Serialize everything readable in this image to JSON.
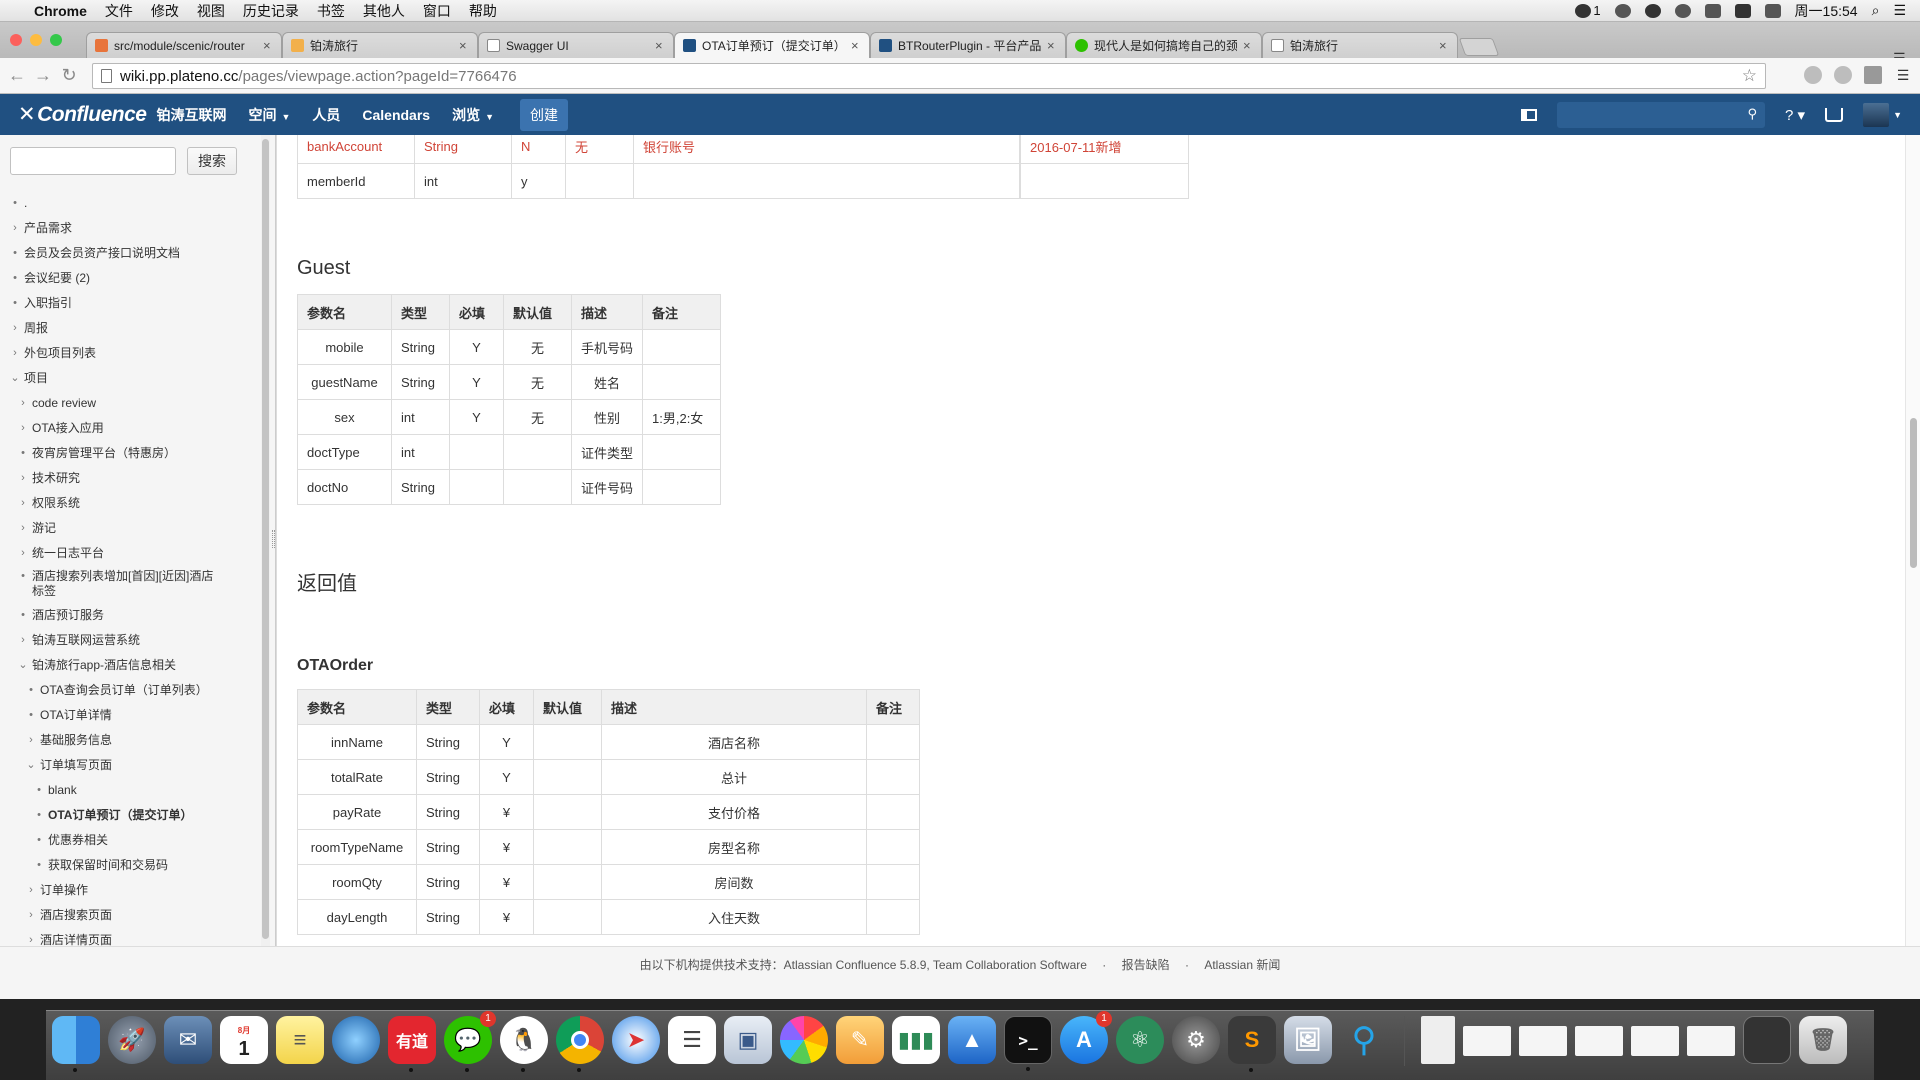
{
  "menubar": {
    "app": "Chrome",
    "items": [
      "文件",
      "修改",
      "视图",
      "历史记录",
      "书签",
      "其他人",
      "窗口",
      "帮助"
    ],
    "wechat_count": "1",
    "clock": "周一15:54"
  },
  "tabs": [
    {
      "label": "src/module/scenic/router",
      "color": "#e8743b"
    },
    {
      "label": "铂涛旅行",
      "color": "#f2b04b"
    },
    {
      "label": "Swagger UI",
      "color": "#ffffff"
    },
    {
      "label": "OTA订单预订（提交订单）",
      "color": "#205081"
    },
    {
      "label": "BTRouterPlugin - 平台产品",
      "color": "#205081"
    },
    {
      "label": "现代人是如何搞垮自己的颈",
      "color": "#2dc100"
    },
    {
      "label": "铂涛旅行",
      "color": "#ffffff"
    }
  ],
  "address": {
    "host": "wiki.pp.plateno.cc",
    "path": "/pages/viewpage.action?pageId=7766476"
  },
  "confluence": {
    "logo": "Confluence",
    "org": "铂涛互联网",
    "nav": {
      "spaces": "空间",
      "people": "人员",
      "calendars": "Calendars",
      "browse": "浏览",
      "create": "创建"
    }
  },
  "sidebar": {
    "search_button": "搜索",
    "tree": [
      {
        "label": ".",
        "marker": "•",
        "depth": 0
      },
      {
        "label": "产品需求",
        "marker": "›",
        "depth": 0
      },
      {
        "label": "会员及会员资产接口说明文档",
        "marker": "•",
        "depth": 0
      },
      {
        "label": "会议纪要 (2)",
        "marker": "•",
        "depth": 0
      },
      {
        "label": "入职指引",
        "marker": "•",
        "depth": 0
      },
      {
        "label": "周报",
        "marker": "›",
        "depth": 0
      },
      {
        "label": "外包项目列表",
        "marker": "›",
        "depth": 0
      },
      {
        "label": "项目",
        "marker": "⌄",
        "depth": 0
      },
      {
        "label": "code review",
        "marker": "›",
        "depth": 1
      },
      {
        "label": "OTA接入应用",
        "marker": "›",
        "depth": 1
      },
      {
        "label": "夜宵房管理平台（特惠房）",
        "marker": "•",
        "depth": 1
      },
      {
        "label": "技术研究",
        "marker": "›",
        "depth": 1
      },
      {
        "label": "权限系统",
        "marker": "›",
        "depth": 1
      },
      {
        "label": "游记",
        "marker": "›",
        "depth": 1
      },
      {
        "label": "统一日志平台",
        "marker": "›",
        "depth": 1
      },
      {
        "label": "酒店搜索列表增加[首因][近因]酒店",
        "label2": "标签",
        "marker": "•",
        "depth": 1
      },
      {
        "label": "酒店预订服务",
        "marker": "•",
        "depth": 1
      },
      {
        "label": "铂涛互联网运营系统",
        "marker": "›",
        "depth": 1
      },
      {
        "label": "铂涛旅行app-酒店信息相关",
        "marker": "⌄",
        "depth": 1
      },
      {
        "label": "OTA查询会员订单（订单列表）",
        "marker": "•",
        "depth": 2
      },
      {
        "label": "OTA订单详情",
        "marker": "•",
        "depth": 2
      },
      {
        "label": "基础服务信息",
        "marker": "›",
        "depth": 2
      },
      {
        "label": "订单填写页面",
        "marker": "⌄",
        "depth": 2
      },
      {
        "label": "blank",
        "marker": "•",
        "depth": 3
      },
      {
        "label": "OTA订单预订（提交订单）",
        "marker": "•",
        "depth": 3,
        "bold": true
      },
      {
        "label": "优惠券相关",
        "marker": "•",
        "depth": 3
      },
      {
        "label": "获取保留时间和交易码",
        "marker": "•",
        "depth": 3
      },
      {
        "label": "订单操作",
        "marker": "›",
        "depth": 2
      },
      {
        "label": "酒店搜索页面",
        "marker": "›",
        "depth": 2
      },
      {
        "label": "酒店详情页面",
        "marker": "›",
        "depth": 2
      }
    ]
  },
  "content": {
    "top_table": {
      "rows": [
        [
          "bankAccount",
          "String",
          "N",
          "无",
          "银行账号",
          "",
          "2016-07-11新增"
        ],
        [
          "memberId",
          "int",
          "y",
          "",
          "",
          "",
          ""
        ]
      ]
    },
    "guest": {
      "heading": "Guest",
      "headers": [
        "参数名",
        "类型",
        "必填",
        "默认值",
        "描述",
        "备注"
      ],
      "rows": [
        [
          "mobile",
          "String",
          "Y",
          "无",
          "手机号码",
          ""
        ],
        [
          "guestName",
          "String",
          "Y",
          "无",
          "姓名",
          ""
        ],
        [
          "sex",
          "int",
          "Y",
          "无",
          "性别",
          "1:男,2:女"
        ],
        [
          "doctType",
          "int",
          "",
          "",
          "证件类型",
          ""
        ],
        [
          "doctNo",
          "String",
          "",
          "",
          "证件号码",
          ""
        ]
      ]
    },
    "return_heading": "返回值",
    "otaorder": {
      "heading": "OTAOrder",
      "headers": [
        "参数名",
        "类型",
        "必填",
        "默认值",
        "描述",
        "备注"
      ],
      "rows": [
        [
          "innName",
          "String",
          "Y",
          "",
          "酒店名称",
          ""
        ],
        [
          "totalRate",
          "String",
          "Y",
          "",
          "总计",
          ""
        ],
        [
          "payRate",
          "String",
          "¥",
          "",
          "支付价格",
          ""
        ],
        [
          "roomTypeName",
          "String",
          "¥",
          "",
          "房型名称",
          ""
        ],
        [
          "roomQty",
          "String",
          "¥",
          "",
          "房间数",
          ""
        ],
        [
          "dayLength",
          "String",
          "¥",
          "",
          "入住天数",
          ""
        ]
      ]
    }
  },
  "footer": {
    "powered": "由以下机构提供技术支持：Atlassian Confluence 5.8.9, Team Collaboration Software",
    "sep": "·",
    "report": "报告缺陷",
    "news": "Atlassian 新闻"
  },
  "dock": {
    "wechat_badge": "1",
    "appstore_badge": "1",
    "calendar_month": "8月",
    "calendar_day": "1",
    "youdao": "有道"
  }
}
